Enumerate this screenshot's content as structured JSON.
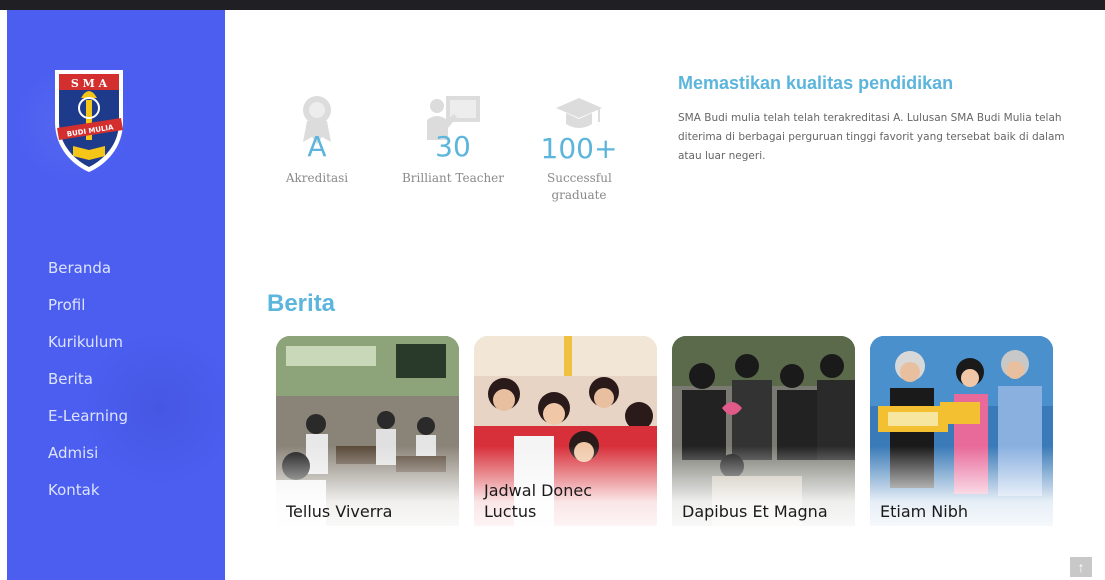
{
  "nav": {
    "items": [
      {
        "label": "Beranda"
      },
      {
        "label": "Profil"
      },
      {
        "label": "Kurikulum"
      },
      {
        "label": "Berita"
      },
      {
        "label": "E-Learning"
      },
      {
        "label": "Admisi"
      },
      {
        "label": "Kontak"
      }
    ]
  },
  "logo": {
    "top_text": "S M A",
    "ribbon_text": "BUDI MULIA"
  },
  "stats": [
    {
      "value": "A",
      "label": "Akreditasi",
      "icon": "award-icon"
    },
    {
      "value": "30",
      "label": "Brilliant Teacher",
      "icon": "teacher-board-icon"
    },
    {
      "value": "100+",
      "label": "Successful graduate",
      "icon": "graduation-cap-icon"
    }
  ],
  "quality": {
    "title": "Memastikan kualitas pendidikan",
    "text": "SMA Budi mulia telah telah terakreditasi A. Lulusan SMA Budi Mulia telah diterima di berbagai perguruan tinggi favorit yang tersebat baik di dalam atau luar negeri."
  },
  "berita": {
    "title": "Berita",
    "cards": [
      {
        "caption": "Tellus Viverra"
      },
      {
        "caption": "Jadwal Donec Luctus"
      },
      {
        "caption": "Dapibus Et Magna"
      },
      {
        "caption": "Etiam Nibh"
      }
    ]
  },
  "colors": {
    "sidebar": "#4b5ef0",
    "accent": "#5bb5dc",
    "topbar": "#1f1f24"
  },
  "scroll_top": {
    "icon": "arrow-up-icon",
    "glyph": "↑"
  }
}
